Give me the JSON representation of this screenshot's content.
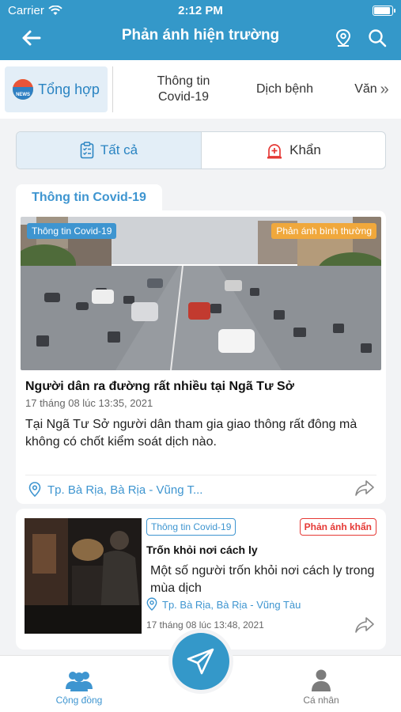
{
  "status_bar": {
    "carrier": "Carrier",
    "time": "2:12 PM"
  },
  "header": {
    "title": "Phản ánh hiện trường",
    "icons": [
      "back-arrow-icon",
      "location-pin-icon",
      "search-icon"
    ]
  },
  "categories": [
    {
      "label": "Tổng hợp",
      "icon": "news-icon",
      "active": true
    },
    {
      "label_line1": "Thông tin",
      "label_line2": "Covid-19"
    },
    {
      "label": "Dịch bệnh"
    },
    {
      "label": "Văn",
      "more": "»"
    }
  ],
  "filter": {
    "all_label": "Tất cả",
    "urgent_label": "Khẩn",
    "selected": "all"
  },
  "section_label": "Thông tin Covid-19",
  "posts": [
    {
      "category_badge": "Thông tin Covid-19",
      "type_badge": "Phản ánh bình thường",
      "title": "Người dân ra đường rất nhiều tại Ngã Tư Sở",
      "date": "17 tháng 08 lúc 13:35, 2021",
      "description": "Tại Ngã Tư Sở người dân tham gia giao thông rất đông mà không có chốt kiểm soát dịch nào.",
      "location": "Tp. Bà Rịa, Bà Rịa - Vũng T..."
    },
    {
      "category_badge": "Thông tin Covid-19",
      "type_badge": "Phản ánh khẩn",
      "title": "Trốn khỏi nơi cách ly",
      "description": "Một số người trốn khỏi nơi cách ly trong mùa dịch",
      "location": "Tp. Bà Rịa, Bà Rịa - Vũng Tàu",
      "date": "17 tháng 08 lúc 13:48, 2021"
    }
  ],
  "bottom_nav": {
    "community_label": "Cộng đồng",
    "personal_label": "Cá nhân"
  },
  "colors": {
    "primary": "#3498c9",
    "accent": "#3e95d0",
    "urgent": "#e53935",
    "normal": "#f0a83c"
  }
}
